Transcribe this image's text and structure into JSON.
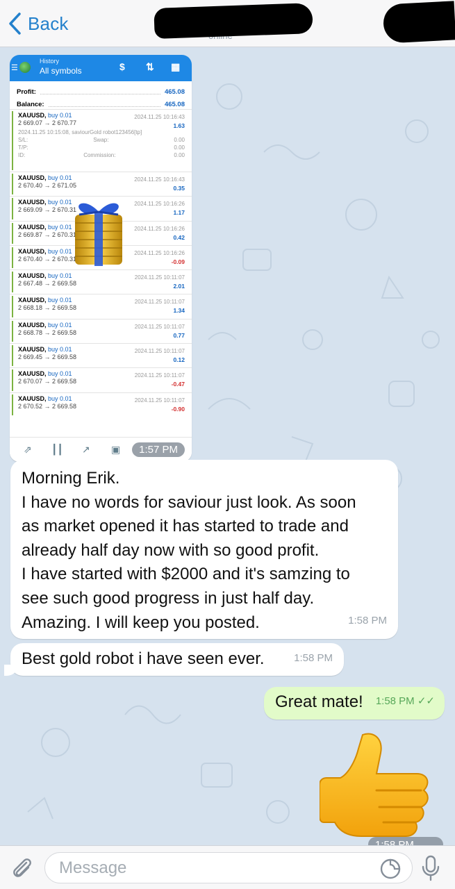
{
  "header": {
    "back_label": "Back",
    "status_peek": "online"
  },
  "screenshot": {
    "app_subtitle": "History",
    "app_title": "All symbols",
    "summary": [
      {
        "label": "Profit:",
        "value": "465.08"
      },
      {
        "label": "Balance:",
        "value": "465.08"
      }
    ],
    "expanded_trade": {
      "comment": "2024.11.25 10:15:08, saviourGold robot123456[tp]",
      "rows": [
        {
          "label": "S/L:",
          "mid": "Swap:",
          "value": "0.00"
        },
        {
          "label": "T/P:",
          "mid": "",
          "value": "0.00"
        },
        {
          "label": "ID:",
          "mid": "Commission:",
          "value": "0.00"
        }
      ]
    },
    "trades": [
      {
        "symbol": "XAUUSD,",
        "side": "buy 0.01",
        "prices": "2 669.07 → 2 670.77",
        "datetime": "2024.11.25 10:16:43",
        "profit": "1.63",
        "neg": false
      },
      {
        "symbol": "XAUUSD,",
        "side": "buy 0.01",
        "prices": "2 670.40 → 2 671.05",
        "datetime": "2024.11.25 10:16:43",
        "profit": "0.35",
        "neg": false
      },
      {
        "symbol": "XAUUSD,",
        "side": "buy 0.01",
        "prices": "2 669.09 → 2 670.31",
        "datetime": "2024.11.25 10:16:26",
        "profit": "1.17",
        "neg": false
      },
      {
        "symbol": "XAUUSD,",
        "side": "buy 0.01",
        "prices": "2 669.87 → 2 670.31",
        "datetime": "2024.11.25 10:16:26",
        "profit": "0.42",
        "neg": false
      },
      {
        "symbol": "XAUUSD,",
        "side": "buy 0.01",
        "prices": "2 670.40 → 2 670.31",
        "datetime": "2024.11.25 10:16:26",
        "profit": "-0.09",
        "neg": true
      },
      {
        "symbol": "XAUUSD,",
        "side": "buy 0.01",
        "prices": "2 667.48 → 2 669.58",
        "datetime": "2024.11.25 10:11:07",
        "profit": "2.01",
        "neg": false
      },
      {
        "symbol": "XAUUSD,",
        "side": "buy 0.01",
        "prices": "2 668.18 → 2 669.58",
        "datetime": "2024.11.25 10:11:07",
        "profit": "1.34",
        "neg": false
      },
      {
        "symbol": "XAUUSD,",
        "side": "buy 0.01",
        "prices": "2 668.78 → 2 669.58",
        "datetime": "2024.11.25 10:11:07",
        "profit": "0.77",
        "neg": false
      },
      {
        "symbol": "XAUUSD,",
        "side": "buy 0.01",
        "prices": "2 669.45 → 2 669.58",
        "datetime": "2024.11.25 10:11:07",
        "profit": "0.12",
        "neg": false
      },
      {
        "symbol": "XAUUSD,",
        "side": "buy 0.01",
        "prices": "2 670.07 → 2 669.58",
        "datetime": "2024.11.25 10:11:07",
        "profit": "-0.47",
        "neg": true
      },
      {
        "symbol": "XAUUSD,",
        "side": "buy 0.01",
        "prices": "2 670.52 → 2 669.58",
        "datetime": "2024.11.25 10:11:07",
        "profit": "-0.90",
        "neg": true
      }
    ],
    "time": "1:57 PM"
  },
  "messages": {
    "m1_lines": [
      "Morning Erik.",
      "I have no words for saviour just look. As soon",
      "as market opened it has started to trade and",
      "already half day now with so good profit.",
      "I have started with $2000 and it's samzing to",
      "see such good progress in just half day.",
      "Amazing. I will keep you posted."
    ],
    "m1_time": "1:58 PM",
    "m2_text": "Best gold robot i have seen ever.",
    "m2_time": "1:58 PM",
    "m3_text": "Great mate!",
    "m3_time": "1:58 PM",
    "sticker_time": "1:58 PM"
  },
  "composer": {
    "placeholder": "Message"
  },
  "colors": {
    "accent": "#2481cc",
    "chat_bg": "#d6e2ee",
    "outgoing_bubble": "#e2fbc9",
    "mt_header": "#1e88e5"
  },
  "icons": [
    "chevron-left-icon",
    "attach-icon",
    "sticker-icon",
    "microphone-icon",
    "thumbs-up-sticker",
    "gold-gift-sticker"
  ]
}
